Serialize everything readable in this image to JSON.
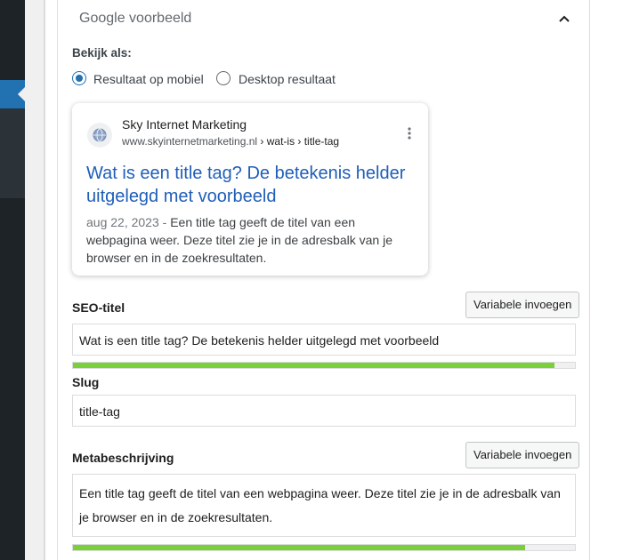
{
  "box": {
    "title": "Google voorbeeld"
  },
  "view": {
    "label": "Bekijk als:",
    "options": [
      "Resultaat op mobiel",
      "Desktop resultaat"
    ],
    "selected": "Resultaat op mobiel"
  },
  "preview": {
    "site_name": "Sky Internet Marketing",
    "url_main": "www.skyinternetmarketing.nl",
    "url_crumbs": " › wat-is › title-tag",
    "title": "Wat is een title tag? De betekenis helder uitgelegd met voorbeeld",
    "date": "aug 22, 2023",
    "separator": " - ",
    "description": "Een title tag geeft de titel van een webpagina weer. Deze titel zie je in de adresbalk van je browser en in de zoekresultaten."
  },
  "seo_title": {
    "label": "SEO-titel",
    "button": "Variabele invoegen",
    "value": "Wat is een title tag? De betekenis helder uitgelegd met voorbeeld",
    "progress": 0.96
  },
  "slug": {
    "label": "Slug",
    "value": "title-tag"
  },
  "meta": {
    "label": "Metabeschrijving",
    "button": "Variabele invoegen",
    "value": "Een title tag geeft de titel van een webpagina weer. Deze titel zie je in de adresbalk van je browser en in de zoekresultaten.",
    "progress": 0.9
  },
  "colors": {
    "accent": "#2271b1",
    "link": "#1f5eb8",
    "progress_good": "#7ad03a",
    "sidebar": "#1d2327"
  },
  "icons": [
    "chevron-up-icon",
    "globe-icon",
    "more-vertical-icon"
  ]
}
